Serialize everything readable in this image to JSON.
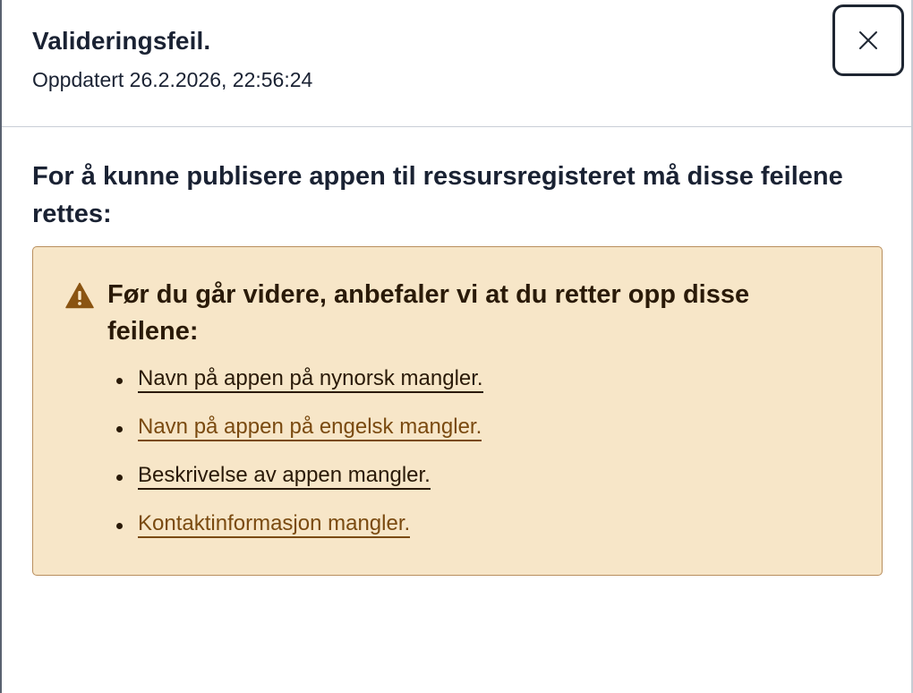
{
  "dialog": {
    "title": "Valideringsfeil.",
    "updated": "Oppdatert 26.2.2026, 22:56:24",
    "close_icon": "close-icon"
  },
  "intro": "For å kunne publisere appen til ressursregisteret må disse feilene rettes:",
  "alert": {
    "icon": "warning-icon",
    "heading": "Før du går videre, anbefaler vi at du retter opp disse feilene:",
    "items": [
      {
        "label": "Navn på appen på nynorsk mangler."
      },
      {
        "label": "Navn på appen på engelsk mangler."
      },
      {
        "label": "Beskrivelse av appen mangler."
      },
      {
        "label": "Kontaktinformasjon mangler."
      }
    ]
  },
  "colors": {
    "alert_background": "#f7e6c8",
    "alert_border": "#b98f5e",
    "warning_icon": "#8a5412",
    "text": "#1a2233"
  }
}
